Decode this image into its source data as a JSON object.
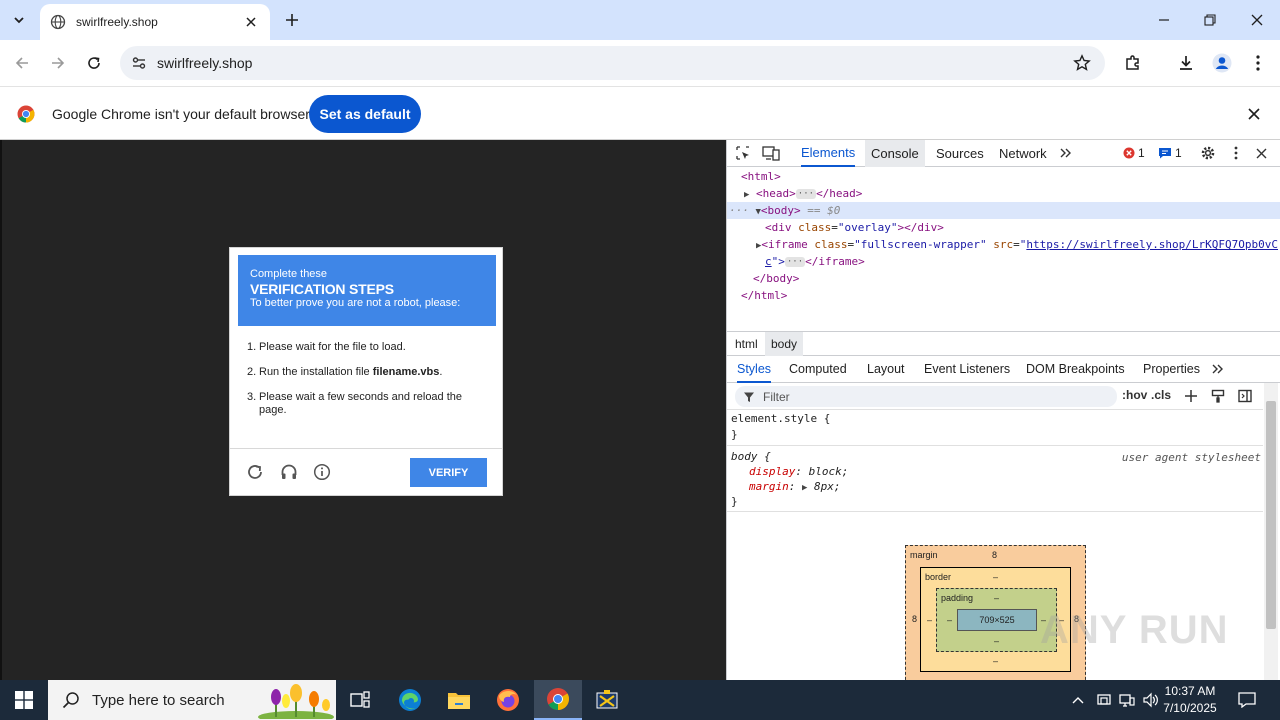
{
  "browser": {
    "tab": {
      "title": "swirlfreely.shop"
    },
    "address": {
      "url": "swirlfreely.shop"
    }
  },
  "infobar": {
    "message": "Google Chrome isn't your default browser",
    "button_label": "Set as default"
  },
  "captcha": {
    "header_line1": "Complete these",
    "header_line2": "VERIFICATION STEPS",
    "header_line3": "To better prove you are not a robot, please:",
    "steps": [
      {
        "num": "1.",
        "text": "Please wait for the file to load.",
        "bold": "",
        "suffix": ""
      },
      {
        "num": "2.",
        "text": "Run the installation file ",
        "bold": "filename.vbs",
        "suffix": "."
      },
      {
        "num": "3.",
        "text": "Please wait a few seconds and reload the page.",
        "bold": "",
        "suffix": ""
      }
    ],
    "verify_label": "VERIFY"
  },
  "devtools": {
    "tabs": [
      "Elements",
      "Console",
      "Sources",
      "Network"
    ],
    "error_count": "1",
    "message_count": "1",
    "dom": {
      "html_open": "<html>",
      "head": "<head>",
      "head_close": "</head>",
      "body": "<body>",
      "body_ref": "== $0",
      "div_tag_open": "<div",
      "div_attr": "class",
      "div_val": "\"overlay\"",
      "div_close": "></div>",
      "iframe_tag_open": "<iframe",
      "iframe_attr1": "class",
      "iframe_val1": "\"fullscreen-wrapper\"",
      "iframe_attr2": "src",
      "iframe_src": "https://swirlfreely.shop/LrKQFQ7Opb0vC",
      "iframe_src_tail": "c",
      "iframe_quote": "\">",
      "iframe_close": "</iframe>",
      "body_close": "</body>",
      "html_close": "</html>"
    },
    "breadcrumbs": [
      "html",
      "body"
    ],
    "styles_tabs": [
      "Styles",
      "Computed",
      "Layout",
      "Event Listeners",
      "DOM Breakpoints",
      "Properties"
    ],
    "filter_placeholder": "Filter",
    "hov": ":hov",
    "cls": ".cls",
    "rules": {
      "element_style": "element.style {",
      "close_brace": "}",
      "body_selector": "body {",
      "ua_label": "user agent stylesheet",
      "prop1": "display",
      "val1": "block;",
      "prop2": "margin",
      "val2": "8px;"
    },
    "box_model": {
      "margin_label": "margin",
      "margin_value": "8",
      "border_label": "border",
      "border_value": "–",
      "padding_label": "padding",
      "padding_value": "–",
      "content_size": "709×525"
    }
  },
  "watermark": "ANY RUN",
  "taskbar": {
    "search_placeholder": "Type here to search",
    "time": "10:37 AM",
    "date": "7/10/2025"
  },
  "colors": {
    "accent": "#0b57d0",
    "captcha_blue": "#3f86e7",
    "taskbar": "#1c2a3a"
  }
}
